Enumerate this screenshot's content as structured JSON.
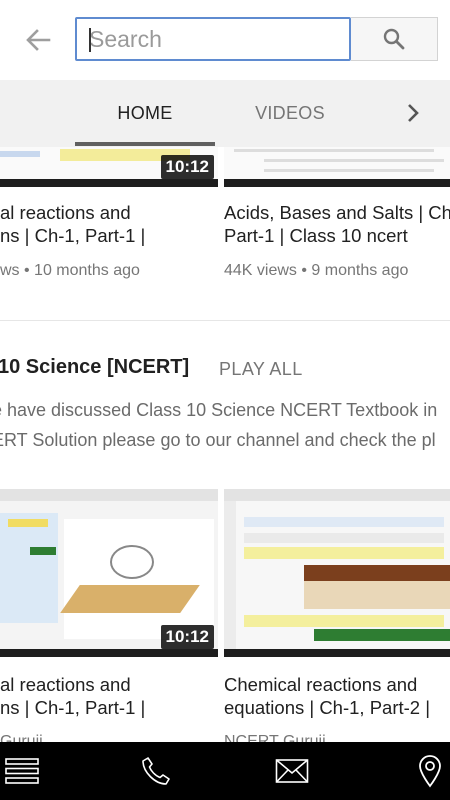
{
  "search": {
    "placeholder": "Search"
  },
  "tabs": [
    {
      "label": "HOME",
      "active": true
    },
    {
      "label": "VIDEOS",
      "active": false
    }
  ],
  "row1": [
    {
      "title_line1": "al reactions and",
      "title_line2": "ns | Ch-1, Part-1 |",
      "meta": "ws • 10 months ago",
      "duration": "10:12"
    },
    {
      "title_line1": "Acids, Bases and Salts | Ch",
      "title_line2": "Part-1 | Class 10 ncert",
      "meta": "44K views • 9 months ago",
      "duration": ""
    }
  ],
  "section": {
    "title": "10 Science [NCERT]",
    "play_all": "PLAY ALL",
    "desc_line1": "e have discussed Class 10 Science NCERT Textbook in",
    "desc_line2": "ERT Solution please go to our channel and check the pl"
  },
  "row2": [
    {
      "title_line1": "al reactions and",
      "title_line2": "ns | Ch-1, Part-1 |",
      "meta": "Gurujj",
      "duration": "10:12"
    },
    {
      "title_line1": "Chemical reactions and",
      "title_line2": "equations | Ch-1, Part-2 |",
      "meta": "NCERT Gurujj",
      "duration": ""
    }
  ],
  "icons": {
    "back": "back-arrow-icon",
    "search": "search-icon",
    "next": "chevron-right-icon",
    "menu": "menu-icon",
    "phone": "phone-icon",
    "mail": "mail-icon",
    "location": "location-pin-icon"
  },
  "colors": {
    "search_border": "#5f8bd0",
    "tabs_bg": "#f1f1f1",
    "bottom_nav": "#000000"
  }
}
